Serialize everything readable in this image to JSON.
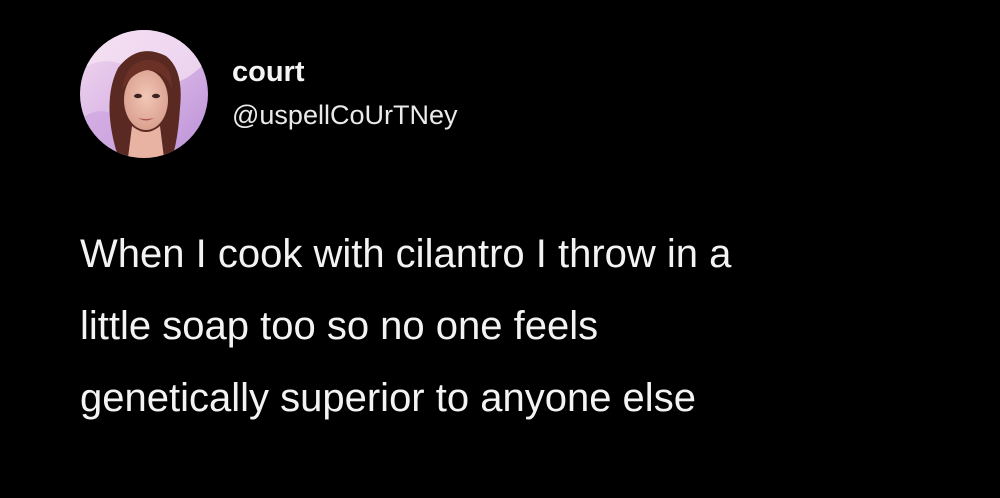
{
  "tweet": {
    "display_name": "court",
    "handle": "@uspellCoUrTNey",
    "text_lines": [
      "When I cook with cilantro I throw in a",
      "little soap too so no one feels",
      "genetically superior to anyone else"
    ]
  },
  "colors": {
    "background": "#000000",
    "text": "#f3f3f3"
  }
}
